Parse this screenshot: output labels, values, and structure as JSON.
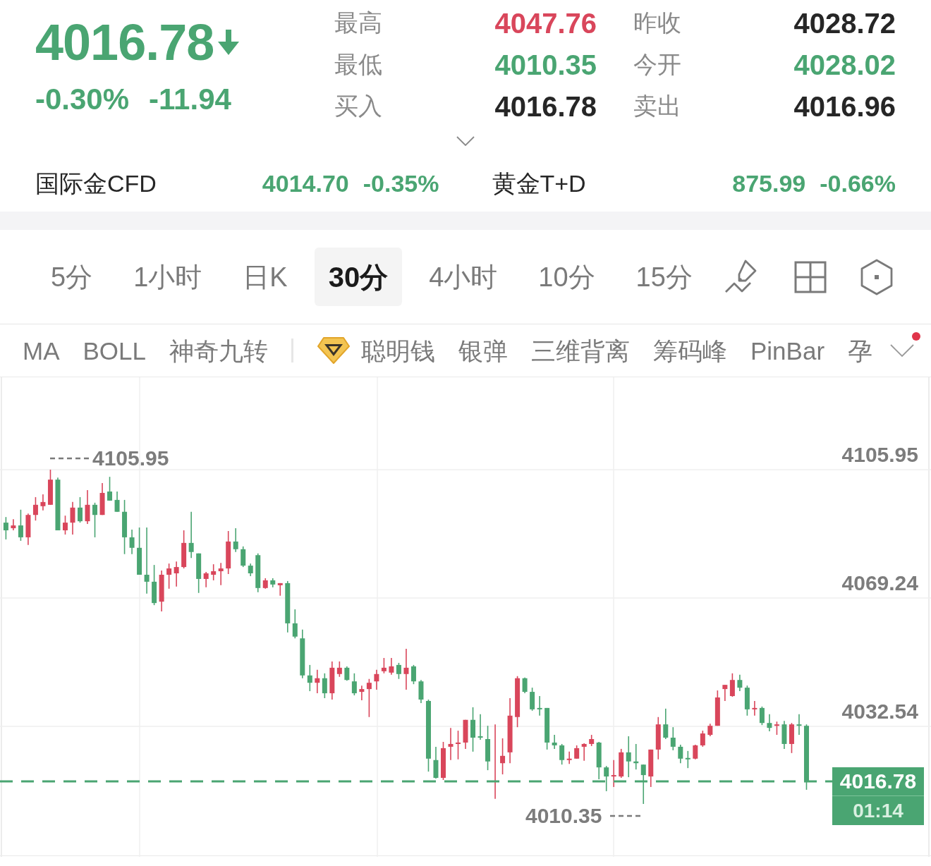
{
  "quote": {
    "price": "4016.78",
    "falling": true,
    "change_percent": "-0.30%",
    "change": "-11.94"
  },
  "stats": [
    {
      "label": "最高",
      "value": "4047.76",
      "color": "#d9465b"
    },
    {
      "label": "昨收",
      "value": "4028.72",
      "color": "#262626"
    },
    {
      "label": "最低",
      "value": "4010.35",
      "color": "#4aa572"
    },
    {
      "label": "今开",
      "value": "4028.02",
      "color": "#4aa572"
    },
    {
      "label": "买入",
      "value": "4016.78",
      "color": "#262626"
    },
    {
      "label": "卖出",
      "value": "4016.96",
      "color": "#262626"
    }
  ],
  "details_toggle": {
    "expanded": false
  },
  "related_quotes": [
    {
      "name": "国际金CFD",
      "price": "4014.70",
      "change": "-0.35%",
      "color": "#4aa572"
    },
    {
      "name": "黄金T+D",
      "price": "875.99",
      "change": "-0.66%",
      "color": "#4aa572"
    }
  ],
  "periods": [
    {
      "label": "5分",
      "selected": false
    },
    {
      "label": "1小时",
      "selected": false
    },
    {
      "label": "日K",
      "selected": false
    },
    {
      "label": "30分",
      "selected": true
    },
    {
      "label": "4小时",
      "selected": false
    },
    {
      "label": "10分",
      "selected": false
    },
    {
      "label": "15分",
      "selected": false
    }
  ],
  "indicators": [
    {
      "label": "MA",
      "kind": "basic",
      "selected": false
    },
    {
      "label": "BOLL",
      "kind": "basic",
      "selected": false
    },
    {
      "label": "神奇九转",
      "kind": "basic",
      "selected": false
    },
    {
      "label": "聪明钱",
      "kind": "premium",
      "selected": false
    },
    {
      "label": "银弹",
      "kind": "basic",
      "selected": false
    },
    {
      "label": "三维背离",
      "kind": "basic",
      "selected": false
    },
    {
      "label": "筹码峰",
      "kind": "basic",
      "selected": false
    },
    {
      "label": "PinBar",
      "kind": "basic",
      "selected": false
    },
    {
      "label": "孕",
      "kind": "basic",
      "selected": false
    }
  ],
  "indicator_menu": {
    "notification": true
  },
  "chart": {
    "chart_data": {
      "type": "candlestick",
      "categories": [
        null,
        null,
        null,
        null,
        null,
        null,
        null,
        null,
        null,
        null,
        null,
        null,
        null,
        null,
        null,
        null,
        null,
        null,
        null,
        null,
        null,
        null,
        null,
        null,
        null,
        null,
        null,
        null,
        null,
        null,
        null,
        null,
        null,
        null,
        null,
        null,
        null,
        null,
        null,
        null,
        null,
        null,
        null,
        null,
        null,
        null,
        null,
        null,
        null,
        null,
        null,
        null,
        null,
        null,
        null,
        null,
        null,
        null,
        null,
        null,
        null,
        null,
        null,
        null,
        null,
        null,
        null,
        null,
        null,
        null,
        null,
        null,
        null,
        null,
        null,
        null,
        null,
        null,
        null,
        null,
        null,
        null,
        null,
        null,
        null,
        null,
        null,
        null,
        null,
        null,
        null,
        null,
        null,
        null,
        null,
        null,
        null,
        null,
        null,
        null,
        null,
        null,
        null,
        null,
        null,
        null,
        null,
        null,
        null
      ],
      "ohlc": [
        [
          4090.8,
          4092.4,
          4086.0,
          4088.6
        ],
        [
          4089.2,
          4091.8,
          4088.6,
          4090.0
        ],
        [
          4090.0,
          4094.5,
          4085.6,
          4086.6
        ],
        [
          4086.6,
          4093.4,
          4084.4,
          4093.0
        ],
        [
          4093.0,
          4098.1,
          4091.4,
          4095.9
        ],
        [
          4095.5,
          4098.9,
          4094.3,
          4096.7
        ],
        [
          4095.9,
          4105.95,
          4095.9,
          4103.1
        ],
        [
          4103.1,
          4103.7,
          4088.6,
          4088.6
        ],
        [
          4088.6,
          4092.8,
          4087.4,
          4090.8
        ],
        [
          4090.8,
          4096.7,
          4087.4,
          4095.1
        ],
        [
          4095.1,
          4098.1,
          4090.8,
          4091.2
        ],
        [
          4091.2,
          4100.1,
          4090.4,
          4095.9
        ],
        [
          4095.9,
          4096.5,
          4086.6,
          4093.0
        ],
        [
          4093.0,
          4102.1,
          4093.0,
          4099.3
        ],
        [
          4099.7,
          4103.9,
          4097.1,
          4097.1
        ],
        [
          4097.3,
          4099.7,
          4093.9,
          4093.9
        ],
        [
          4093.9,
          4097.3,
          4081.8,
          4086.6
        ],
        [
          4086.6,
          4088.8,
          4081.8,
          4083.6
        ],
        [
          4083.6,
          4089.4,
          4075.9,
          4075.9
        ],
        [
          4075.9,
          4089.4,
          4070.5,
          4073.9
        ],
        [
          4073.9,
          4078.7,
          4067.2,
          4067.8
        ],
        [
          4068.2,
          4077.1,
          4065.4,
          4075.9
        ],
        [
          4075.9,
          4079.1,
          4071.9,
          4077.7
        ],
        [
          4076.3,
          4079.7,
          4072.5,
          4078.1
        ],
        [
          4078.1,
          4088.6,
          4077.7,
          4085.0
        ],
        [
          4085.0,
          4093.9,
          4080.7,
          4082.4
        ],
        [
          4082.0,
          4082.0,
          4070.7,
          4074.7
        ],
        [
          4074.7,
          4076.7,
          4072.3,
          4076.3
        ],
        [
          4075.9,
          4078.9,
          4074.3,
          4076.9
        ],
        [
          4076.9,
          4079.3,
          4072.9,
          4077.7
        ],
        [
          4077.7,
          4088.4,
          4076.1,
          4085.4
        ],
        [
          4085.4,
          4089.2,
          4082.4,
          4083.2
        ],
        [
          4083.2,
          4084.0,
          4078.1,
          4078.5
        ],
        [
          4078.5,
          4079.1,
          4075.5,
          4076.3
        ],
        [
          4081.5,
          4082.0,
          4070.9,
          4072.1
        ],
        [
          4072.1,
          4074.9,
          4071.9,
          4074.3
        ],
        [
          4074.3,
          4074.9,
          4072.3,
          4073.1
        ],
        [
          4072.9,
          4073.5,
          4069.9,
          4073.5
        ],
        [
          4073.5,
          4074.1,
          4059.4,
          4062.0
        ],
        [
          4062.0,
          4066.0,
          4057.7,
          4058.2
        ],
        [
          4057.7,
          4060.2,
          4046.3,
          4047.1
        ],
        [
          4047.1,
          4050.1,
          4042.6,
          4045.0
        ],
        [
          4045.0,
          4048.7,
          4042.0,
          4046.3
        ],
        [
          4046.3,
          4047.7,
          4040.6,
          4042.0
        ],
        [
          4042.0,
          4051.1,
          4040.2,
          4049.3
        ],
        [
          4047.5,
          4051.1,
          4046.7,
          4049.3
        ],
        [
          4049.3,
          4049.7,
          4045.6,
          4045.8
        ],
        [
          4045.4,
          4047.7,
          4041.4,
          4042.0
        ],
        [
          4042.4,
          4044.2,
          4040.0,
          4043.2
        ],
        [
          4043.2,
          4046.1,
          4035.2,
          4045.0
        ],
        [
          4045.4,
          4048.7,
          4043.0,
          4047.5
        ],
        [
          4048.3,
          4052.1,
          4047.7,
          4049.3
        ],
        [
          4047.9,
          4052.1,
          4047.3,
          4049.7
        ],
        [
          4050.1,
          4050.7,
          4046.1,
          4047.5
        ],
        [
          4047.5,
          4054.7,
          4043.0,
          4049.3
        ],
        [
          4049.7,
          4050.1,
          4044.6,
          4045.4
        ],
        [
          4045.4,
          4045.8,
          4039.2,
          4040.2
        ],
        [
          4039.8,
          4040.2,
          4019.6,
          4023.3
        ],
        [
          4022.9,
          4026.7,
          4017.6,
          4017.8
        ],
        [
          4017.8,
          4028.1,
          4017.2,
          4026.3
        ],
        [
          4026.7,
          4032.1,
          4022.9,
          4027.5
        ],
        [
          4027.5,
          4031.3,
          4023.1,
          4027.9
        ],
        [
          4027.9,
          4034.4,
          4026.1,
          4034.4
        ],
        [
          4034.4,
          4038.0,
          4025.3,
          4029.3
        ],
        [
          4029.7,
          4036.0,
          4028.7,
          4029.3
        ],
        [
          4028.9,
          4032.7,
          4020.0,
          4022.5
        ],
        [
          4016.6,
          4033.1,
          4011.8,
          4017.0
        ],
        [
          4022.0,
          4029.1,
          4018.8,
          4024.1
        ],
        [
          4025.1,
          4040.6,
          4022.0,
          4035.6
        ],
        [
          4035.2,
          4046.9,
          4032.3,
          4046.3
        ],
        [
          4046.3,
          4046.5,
          4042.0,
          4042.4
        ],
        [
          4042.4,
          4043.6,
          4037.0,
          4037.4
        ],
        [
          4037.8,
          4041.2,
          4035.6,
          4037.4
        ],
        [
          4037.8,
          4037.8,
          4025.9,
          4027.9
        ],
        [
          4027.9,
          4030.1,
          4026.1,
          4027.1
        ],
        [
          4027.1,
          4027.5,
          4021.6,
          4022.9
        ],
        [
          4022.9,
          4025.3,
          4021.8,
          4023.3
        ],
        [
          4023.3,
          4027.1,
          4023.3,
          4026.3
        ],
        [
          4026.7,
          4027.7,
          4022.7,
          4027.5
        ],
        [
          4027.5,
          4030.1,
          4026.9,
          4028.9
        ],
        [
          4027.9,
          4028.1,
          4017.4,
          4020.8
        ],
        [
          4020.8,
          4021.2,
          4014.0,
          4018.2
        ],
        [
          4018.2,
          4022.9,
          4015.2,
          4018.6
        ],
        [
          4018.2,
          4026.1,
          4017.8,
          4025.1
        ],
        [
          4025.1,
          4029.7,
          4018.0,
          4022.5
        ],
        [
          4022.5,
          4027.5,
          4020.2,
          4022.0
        ],
        [
          4021.6,
          4021.6,
          4010.35,
          4018.6
        ],
        [
          4018.2,
          4025.9,
          4015.2,
          4025.9
        ],
        [
          4025.9,
          4035.2,
          4023.1,
          4033.1
        ],
        [
          4033.1,
          4037.6,
          4028.9,
          4029.3
        ],
        [
          4029.3,
          4032.3,
          4025.7,
          4026.7
        ],
        [
          4026.7,
          4027.3,
          4022.0,
          4023.3
        ],
        [
          4023.5,
          4025.5,
          4020.6,
          4023.1
        ],
        [
          4023.3,
          4027.3,
          4023.1,
          4027.1
        ],
        [
          4027.1,
          4031.3,
          4026.7,
          4030.5
        ],
        [
          4030.1,
          4033.3,
          4029.7,
          4032.7
        ],
        [
          4032.7,
          4042.8,
          4032.7,
          4040.8
        ],
        [
          4043.2,
          4044.4,
          4039.8,
          4044.4
        ],
        [
          4041.2,
          4047.7,
          4041.0,
          4045.8
        ],
        [
          4045.8,
          4047.3,
          4042.6,
          4043.6
        ],
        [
          4043.6,
          4044.2,
          4035.6,
          4037.4
        ],
        [
          4037.4,
          4039.8,
          4035.6,
          4037.8
        ],
        [
          4037.8,
          4038.2,
          4032.9,
          4033.5
        ],
        [
          4033.5,
          4036.0,
          4031.1,
          4032.1
        ],
        [
          4032.7,
          4033.9,
          4030.1,
          4033.1
        ],
        [
          4033.1,
          4034.1,
          4026.1,
          4027.5
        ],
        [
          4027.5,
          4033.5,
          4024.9,
          4033.1
        ],
        [
          4033.1,
          4036.0,
          4030.1,
          4032.7
        ],
        [
          4032.7,
          4033.1,
          4014.4,
          4016.78
        ]
      ],
      "ylim": [
        3995.22,
        4132.37
      ],
      "yticks": [
        {
          "value": 4105.95,
          "label": "4105.95"
        },
        {
          "value": 4069.24,
          "label": "4069.24"
        },
        {
          "value": 4032.54,
          "label": "4032.54"
        }
      ],
      "grid": true,
      "ref_lines": [
        {
          "axis": "y",
          "value": 4016.78,
          "color": "#4aa572"
        }
      ]
    },
    "high_label": "4105.95",
    "low_label": "4010.35",
    "last_price": "4016.78",
    "countdown": "01:14"
  }
}
